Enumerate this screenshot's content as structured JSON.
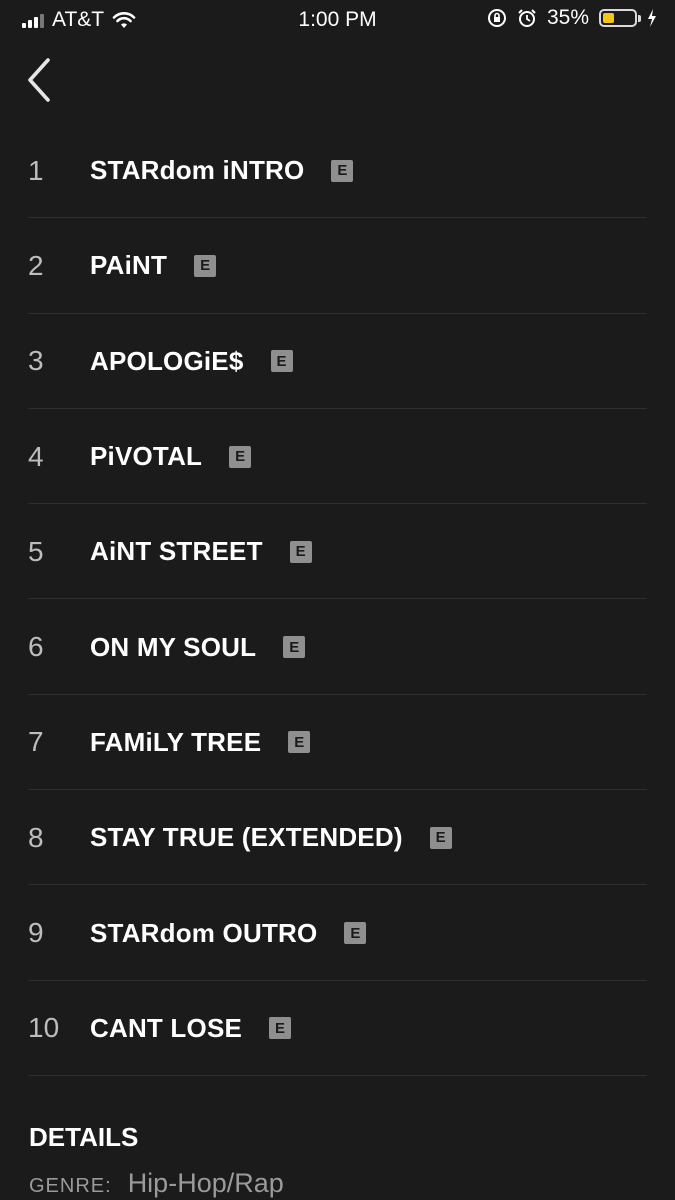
{
  "status_bar": {
    "carrier": "AT&T",
    "time": "1:00 PM",
    "battery_percent": "35%",
    "battery_level": 0.35,
    "icons": [
      "signal-icon",
      "wifi-icon",
      "rotation-lock-icon",
      "alarm-icon",
      "battery-icon",
      "charging-icon"
    ]
  },
  "nav": {
    "back_icon": "chevron-left-icon"
  },
  "explicit_badge": "E",
  "tracks": [
    {
      "number": "1",
      "title": "STARdom iNTRO"
    },
    {
      "number": "2",
      "title": "PAiNT"
    },
    {
      "number": "3",
      "title": "APOLOGiE$"
    },
    {
      "number": "4",
      "title": "PiVOTAL"
    },
    {
      "number": "5",
      "title": "AiNT STREET"
    },
    {
      "number": "6",
      "title": "ON MY SOUL"
    },
    {
      "number": "7",
      "title": "FAMiLY TREE"
    },
    {
      "number": "8",
      "title": "STAY TRUE (EXTENDED)"
    },
    {
      "number": "9",
      "title": "STARdom OUTRO"
    },
    {
      "number": "10",
      "title": "CANT LOSE"
    }
  ],
  "details": {
    "heading": "DETAILS",
    "genre_label": "GENRE:",
    "genre_value": "Hip-Hop/Rap"
  },
  "colors": {
    "background": "#1b1b1b",
    "badge": "#8f8f8f",
    "battery": "#f5c518"
  }
}
